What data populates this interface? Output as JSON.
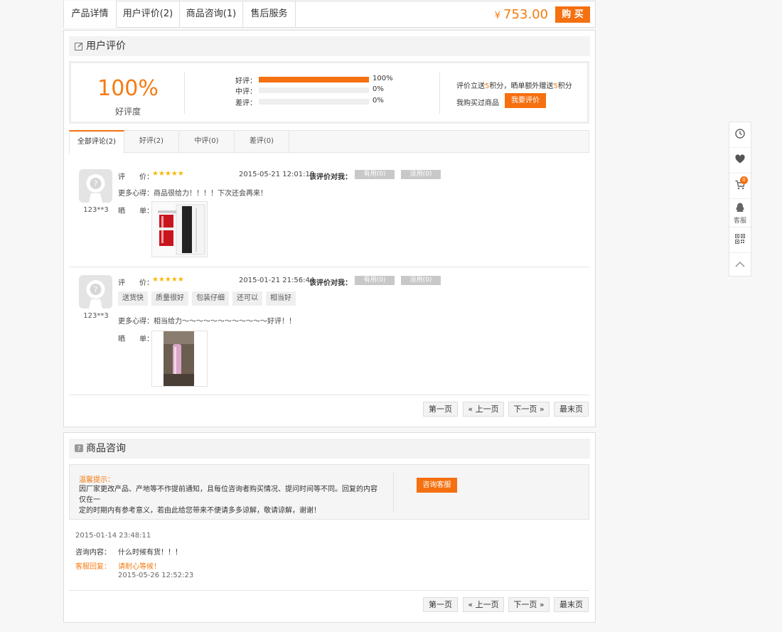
{
  "tabs": [
    {
      "label": "产品详情"
    },
    {
      "label": "用户评价(2)"
    },
    {
      "label": "商品咨询(1)"
    },
    {
      "label": "售后服务"
    }
  ],
  "price": {
    "currency": "¥",
    "amount": "753.00"
  },
  "buy_label": "购 买",
  "reviews_section": {
    "title": "用户评价",
    "rate": "100%",
    "rate_label": "好评度",
    "bars": [
      {
        "label": "好评：",
        "value": 1.0,
        "pct": "100%"
      },
      {
        "label": "中评：",
        "value": 0,
        "pct": "0%"
      },
      {
        "label": "差评：",
        "value": 0,
        "pct": "0%"
      }
    ],
    "promo_pre": "评价立送",
    "promo_n1": "5",
    "promo_mid": "积分，晒单额外赠送",
    "promo_n2": "5",
    "promo_post": "积分",
    "bought_text": "我购买过商品",
    "review_button": "我要评价",
    "filters": [
      {
        "label": "全部评论(2)"
      },
      {
        "label": "好评(2)"
      },
      {
        "label": "中评(0)"
      },
      {
        "label": "差评(0)"
      }
    ],
    "items": [
      {
        "user": "123**3",
        "rate_label": "评　　价：",
        "stars": "★★★★★",
        "date": "2015-05-21 12:01:18",
        "vote_q": "该评价对我：",
        "useful": "有用(0)",
        "useless": "没用(0)",
        "content_label": "更多心得：",
        "content": "商品很给力！！！！下次还会再来！",
        "show_label": "晒　　单："
      },
      {
        "user": "123**3",
        "rate_label": "评　　价：",
        "stars": "★★★★★",
        "date": "2015-01-21 21:56:44",
        "vote_q": "该评价对我：",
        "useful": "有用(0)",
        "useless": "没用(0)",
        "tags": [
          "送货快",
          "质量很好",
          "包装仔细",
          "还可以",
          "相当好"
        ],
        "content_label": "更多心得：",
        "content": "相当给力～～～～～～～～～～～～好评！！",
        "show_label": "晒　　单："
      }
    ]
  },
  "pagination": {
    "first": "第一页",
    "prev": "« 上一页",
    "next": "下一页 »",
    "last": "最末页"
  },
  "consult_section": {
    "title": "商品咨询",
    "notice_title": "温馨提示：",
    "notice_line1": "因厂家更改产品、产地等不作提前通知，且每位咨询者购买情况、提问时间等不同。回复的内容仅在一",
    "notice_line2": "定的时期内有参考意义，若由此给您带来不便请多多谅解，敬请谅解，谢谢！",
    "consult_button": "咨询客服",
    "item": {
      "date": "2015-01-14 23:48:11",
      "q_label": "咨询内容：",
      "question": "什么时候有货！！！",
      "a_label": "客服回复：",
      "answer": "请耐心等候！",
      "answer_date": "2015-05-26 12:52:23"
    }
  },
  "sidebar": {
    "cart_count": "0",
    "service_label": "客服"
  },
  "colors": {
    "accent": "#f57010",
    "price": "#f57b12",
    "star": "#f7b80d"
  }
}
